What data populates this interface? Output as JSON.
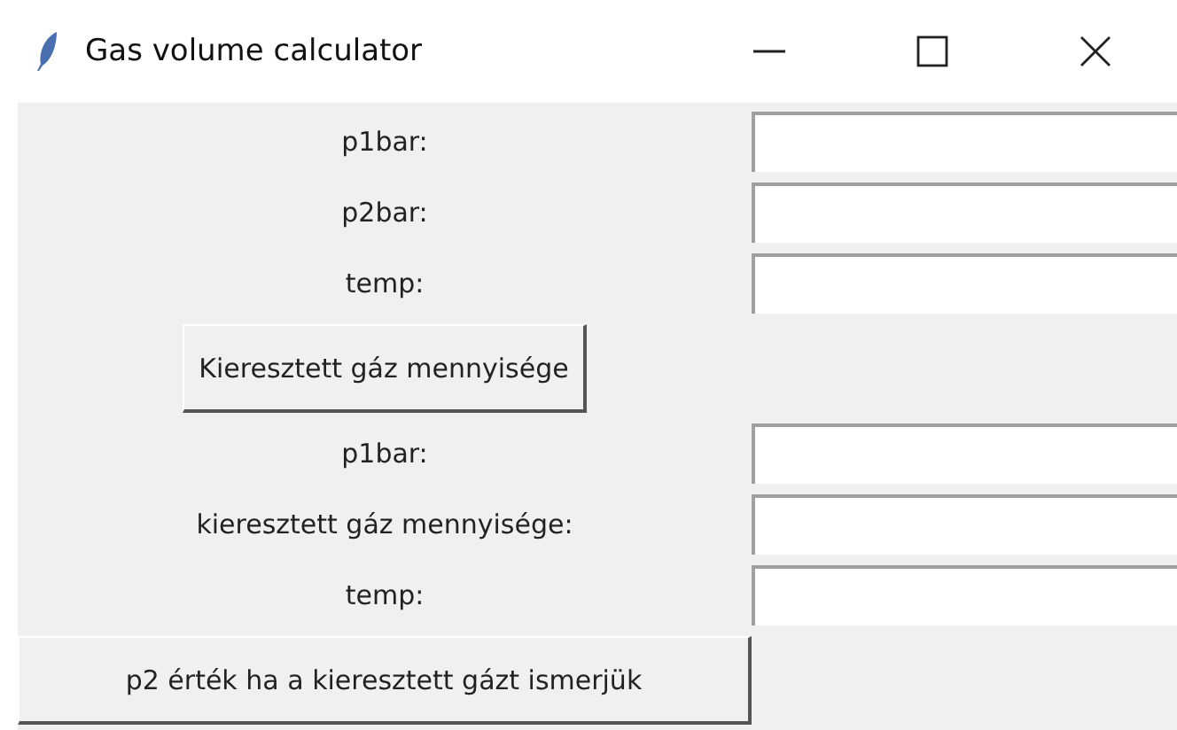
{
  "window": {
    "title": "Gas volume calculator"
  },
  "rows": [
    {
      "kind": "field",
      "label": "p1bar:"
    },
    {
      "kind": "field",
      "label": "p2bar:"
    },
    {
      "kind": "field",
      "label": "temp:"
    },
    {
      "kind": "button",
      "label": "Kieresztett gáz mennyisége"
    },
    {
      "kind": "field",
      "label": "p1bar:"
    },
    {
      "kind": "field",
      "label": "kieresztett gáz mennyisége:"
    },
    {
      "kind": "field",
      "label": "temp:"
    },
    {
      "kind": "wide_button",
      "label": "p2 érték ha a kieresztett gázt ismerjük"
    }
  ]
}
